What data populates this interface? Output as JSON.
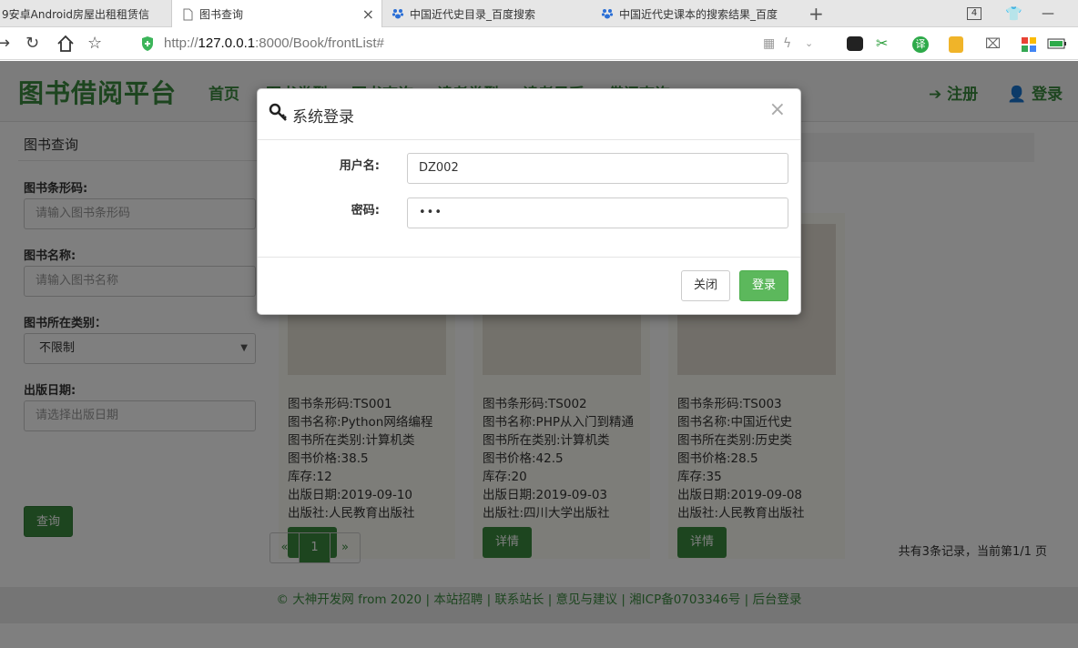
{
  "browser": {
    "tabs": [
      {
        "title": "9安卓Android房屋出租租赁信"
      },
      {
        "title": "图书查询"
      },
      {
        "title": "中国近代史目录_百度搜索"
      },
      {
        "title": "中国近代史课本的搜索结果_百度"
      }
    ],
    "tab_count": "4",
    "url_prefix": "http://",
    "url_host": "127.0.0.1",
    "url_rest": ":8000/Book/frontList#"
  },
  "header": {
    "brand": "图书借阅平台",
    "nav": [
      "首页",
      "图书类型",
      "图书查询",
      "读者类型",
      "读者风采",
      "借阅查询"
    ],
    "register": "注册",
    "login": "登录"
  },
  "sidebar": {
    "title": "图书查询",
    "barcode_label": "图书条形码:",
    "barcode_placeholder": "请输入图书条形码",
    "name_label": "图书名称:",
    "name_placeholder": "请输入图书名称",
    "category_label": "图书所在类别：",
    "category_value": "不限制",
    "date_label": "出版日期:",
    "date_placeholder": "请选择出版日期",
    "query_button": "查询"
  },
  "books": [
    {
      "barcode": "图书条形码:TS001",
      "name": "图书名称:Python网络编程",
      "category": "图书所在类别:计算机类",
      "price": "图书价格:38.5",
      "stock": "库存:12",
      "date": "出版日期:2019-09-10",
      "publisher": "出版社:人民教育出版社",
      "detail": "详情"
    },
    {
      "barcode": "图书条形码:TS002",
      "name": "图书名称:PHP从入门到精通",
      "category": "图书所在类别:计算机类",
      "price": "图书价格:42.5",
      "stock": "库存:20",
      "date": "出版日期:2019-09-03",
      "publisher": "出版社:四川大学出版社",
      "detail": "详情"
    },
    {
      "barcode": "图书条形码:TS003",
      "name": "图书名称:中国近代史",
      "category": "图书所在类别:历史类",
      "price": "图书价格:28.5",
      "stock": "库存:35",
      "date": "出版日期:2019-09-08",
      "publisher": "出版社:人民教育出版社",
      "detail": "详情"
    }
  ],
  "pager": {
    "prev": "«",
    "current": "1",
    "next": "»",
    "summary": "共有3条记录，当前第1/1 页"
  },
  "footer": {
    "text": "© 大神开发网 from 2020 | 本站招聘 | 联系站长 | 意见与建议 | 湘ICP备0703346号 | 后台登录"
  },
  "modal": {
    "title": "系统登录",
    "close_symbol": "×",
    "username_label": "用户名:",
    "username_value": "DZ002",
    "password_label": "密码:",
    "password_value": "•••",
    "close_button": "关闭",
    "login_button": "登录"
  },
  "colors": {
    "accent": "#3a8b3f",
    "login_button": "#5cb85c"
  }
}
